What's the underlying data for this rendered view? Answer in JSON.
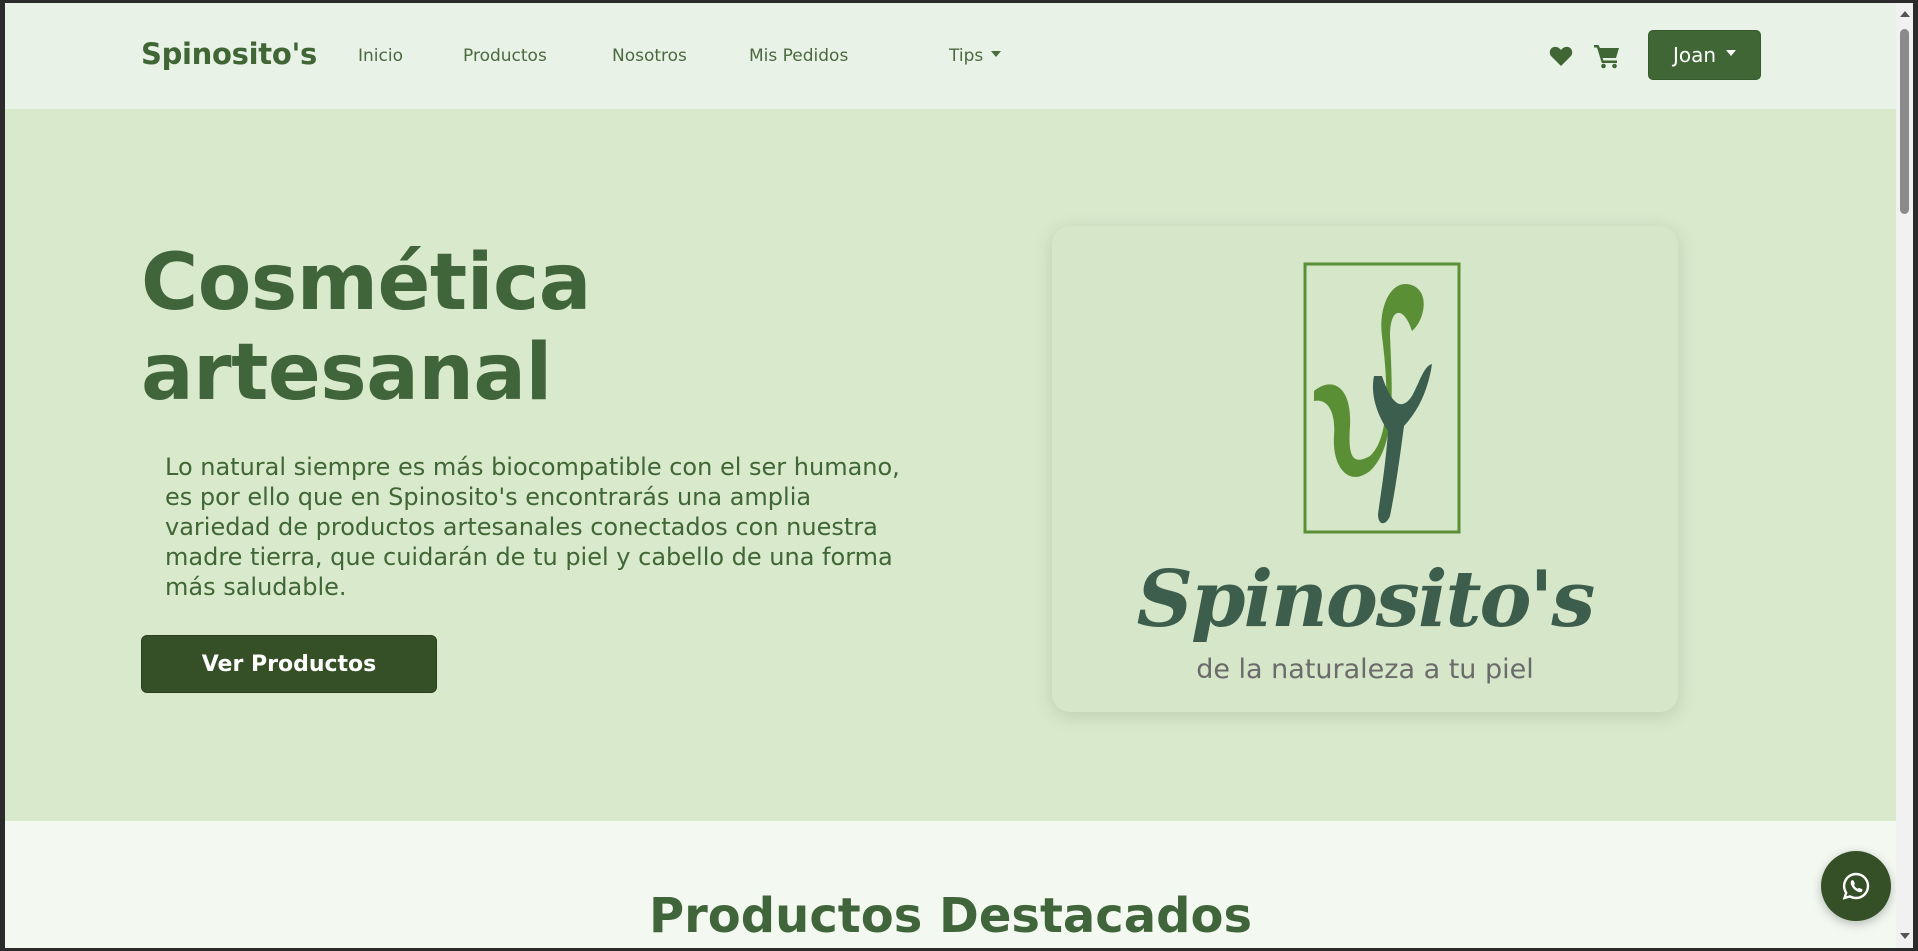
{
  "navbar": {
    "brand": "Spinosito's",
    "links": [
      "Inicio",
      "Productos",
      "Nosotros",
      "Mis Pedidos"
    ],
    "tips_label": "Tips",
    "user_label": "Joan",
    "icons": [
      "heart-icon",
      "cart-icon",
      "chevron-down-icon"
    ]
  },
  "hero": {
    "title": "Cosmética artesanal",
    "description": "Lo natural siempre es más biocompatible con el ser humano, es por ello que en Spinosito's encontrarás una amplia variedad de productos artesanales conectados con nuestra madre tierra, que cuidarán de tu piel y cabello de una forma más saludable.",
    "cta_label": "Ver Productos"
  },
  "logo": {
    "name": "Spinosito's",
    "tagline": "de la naturaleza a tu piel"
  },
  "featured": {
    "title": "Productos Destacados"
  },
  "colors": {
    "primary": "#3f6634",
    "hero_bg": "#d9e9cc",
    "nav_bg": "#e8f2e6",
    "button_dark": "#355026"
  }
}
